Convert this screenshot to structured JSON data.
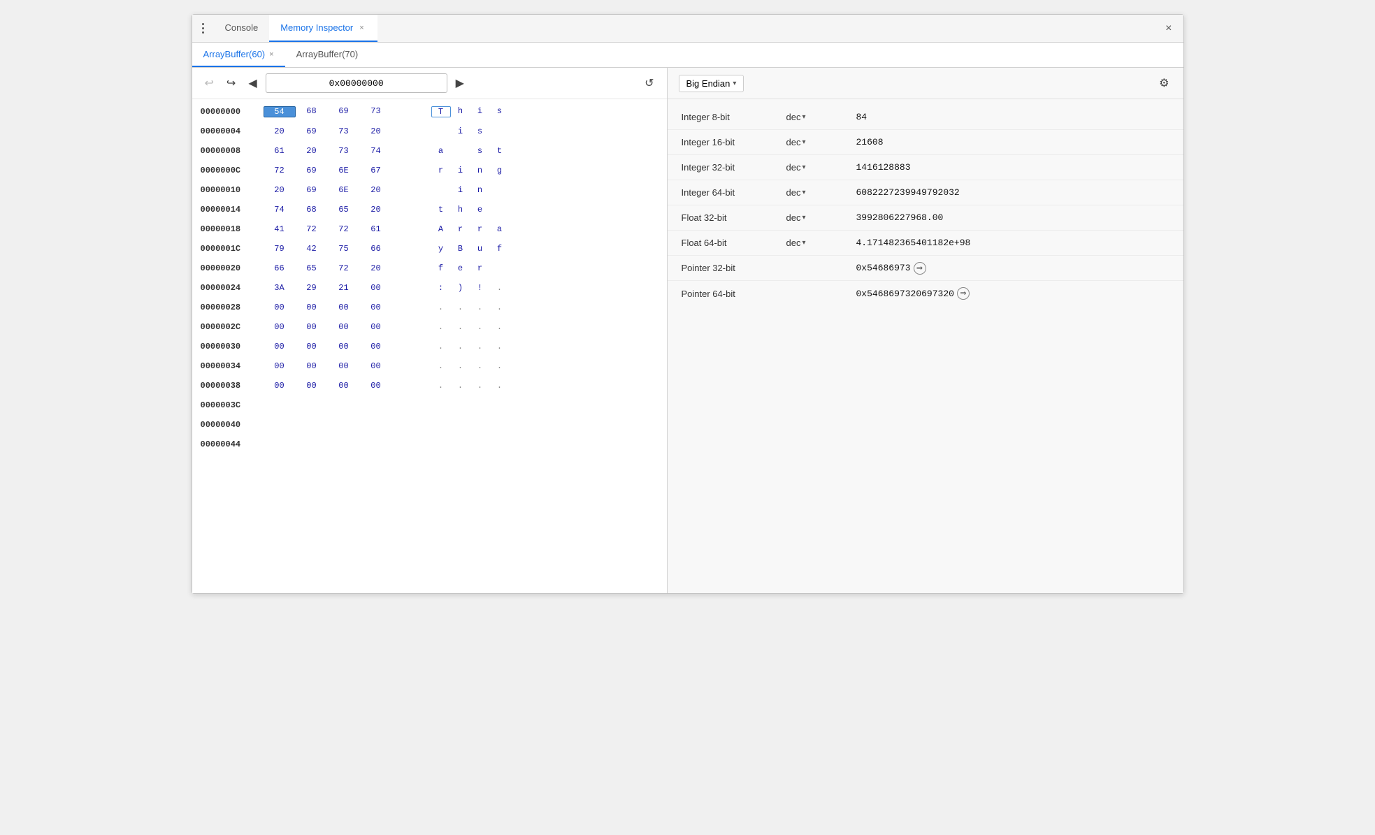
{
  "window": {
    "title": "Memory Inspector",
    "close_label": "×"
  },
  "top_tabs": [
    {
      "id": "console",
      "label": "Console",
      "active": false,
      "closable": false
    },
    {
      "id": "memory-inspector",
      "label": "Memory Inspector",
      "active": true,
      "closable": true
    }
  ],
  "secondary_tabs": [
    {
      "id": "arraybuffer-60",
      "label": "ArrayBuffer(60)",
      "active": true,
      "closable": true
    },
    {
      "id": "arraybuffer-70",
      "label": "ArrayBuffer(70)",
      "active": false,
      "closable": false
    }
  ],
  "nav": {
    "back_disabled": true,
    "forward_disabled": false,
    "address": "0x00000000",
    "prev_icon": "◀",
    "next_icon": "▶",
    "back_icon": "↩",
    "forward_icon": "↪",
    "refresh_icon": "↺"
  },
  "memory_rows": [
    {
      "address": "00000000",
      "bytes": [
        "54",
        "68",
        "69",
        "73"
      ],
      "chars": [
        "T",
        "h",
        "i",
        "s"
      ],
      "byte_selected": 0,
      "char_selected": 0
    },
    {
      "address": "00000004",
      "bytes": [
        "20",
        "69",
        "73",
        "20"
      ],
      "chars": [
        " ",
        "i",
        "s",
        " "
      ],
      "byte_selected": -1,
      "char_selected": -1
    },
    {
      "address": "00000008",
      "bytes": [
        "61",
        "20",
        "73",
        "74"
      ],
      "chars": [
        "a",
        " ",
        "s",
        "t"
      ],
      "byte_selected": -1,
      "char_selected": -1
    },
    {
      "address": "0000000C",
      "bytes": [
        "72",
        "69",
        "6E",
        "67"
      ],
      "chars": [
        "r",
        "i",
        "n",
        "g"
      ],
      "byte_selected": -1,
      "char_selected": -1
    },
    {
      "address": "00000010",
      "bytes": [
        "20",
        "69",
        "6E",
        "20"
      ],
      "chars": [
        " ",
        "i",
        "n",
        " "
      ],
      "byte_selected": -1,
      "char_selected": -1
    },
    {
      "address": "00000014",
      "bytes": [
        "74",
        "68",
        "65",
        "20"
      ],
      "chars": [
        "t",
        "h",
        "e",
        " "
      ],
      "byte_selected": -1,
      "char_selected": -1
    },
    {
      "address": "00000018",
      "bytes": [
        "41",
        "72",
        "72",
        "61"
      ],
      "chars": [
        "A",
        "r",
        "r",
        "a"
      ],
      "byte_selected": -1,
      "char_selected": -1
    },
    {
      "address": "0000001C",
      "bytes": [
        "79",
        "42",
        "75",
        "66"
      ],
      "chars": [
        "y",
        "B",
        "u",
        "f"
      ],
      "byte_selected": -1,
      "char_selected": -1
    },
    {
      "address": "00000020",
      "bytes": [
        "66",
        "65",
        "72",
        "20"
      ],
      "chars": [
        "f",
        "e",
        "r",
        " "
      ],
      "byte_selected": -1,
      "char_selected": -1
    },
    {
      "address": "00000024",
      "bytes": [
        "3A",
        "29",
        "21",
        "00"
      ],
      "chars": [
        ":",
        ")",
        "!",
        "."
      ],
      "byte_selected": -1,
      "char_selected": -1
    },
    {
      "address": "00000028",
      "bytes": [
        "00",
        "00",
        "00",
        "00"
      ],
      "chars": [
        ".",
        ".",
        ".",
        "."
      ],
      "byte_selected": -1,
      "char_selected": -1
    },
    {
      "address": "0000002C",
      "bytes": [
        "00",
        "00",
        "00",
        "00"
      ],
      "chars": [
        ".",
        ".",
        ".",
        "."
      ],
      "byte_selected": -1,
      "char_selected": -1
    },
    {
      "address": "00000030",
      "bytes": [
        "00",
        "00",
        "00",
        "00"
      ],
      "chars": [
        ".",
        ".",
        ".",
        "."
      ],
      "byte_selected": -1,
      "char_selected": -1
    },
    {
      "address": "00000034",
      "bytes": [
        "00",
        "00",
        "00",
        "00"
      ],
      "chars": [
        ".",
        ".",
        ".",
        "."
      ],
      "byte_selected": -1,
      "char_selected": -1
    },
    {
      "address": "00000038",
      "bytes": [
        "00",
        "00",
        "00",
        "00"
      ],
      "chars": [
        ".",
        ".",
        ".",
        "."
      ],
      "byte_selected": -1,
      "char_selected": -1
    },
    {
      "address": "0000003C",
      "bytes": [],
      "chars": [],
      "byte_selected": -1,
      "char_selected": -1
    },
    {
      "address": "00000040",
      "bytes": [],
      "chars": [],
      "byte_selected": -1,
      "char_selected": -1
    },
    {
      "address": "00000044",
      "bytes": [],
      "chars": [],
      "byte_selected": -1,
      "char_selected": -1
    }
  ],
  "right_panel": {
    "endian": "Big Endian",
    "endian_caret": "▾",
    "gear_icon": "⚙",
    "values": [
      {
        "id": "int8",
        "label": "Integer 8-bit",
        "format": "dec",
        "has_dropdown": true,
        "value": "84"
      },
      {
        "id": "int16",
        "label": "Integer 16-bit",
        "format": "dec",
        "has_dropdown": true,
        "value": "21608"
      },
      {
        "id": "int32",
        "label": "Integer 32-bit",
        "format": "dec",
        "has_dropdown": true,
        "value": "1416128883"
      },
      {
        "id": "int64",
        "label": "Integer 64-bit",
        "format": "dec",
        "has_dropdown": true,
        "value": "6082227239949792032"
      },
      {
        "id": "float32",
        "label": "Float 32-bit",
        "format": "dec",
        "has_dropdown": true,
        "value": "3992806227968.00"
      },
      {
        "id": "float64",
        "label": "Float 64-bit",
        "format": "dec",
        "has_dropdown": true,
        "value": "4.171482365401182e+98"
      },
      {
        "id": "ptr32",
        "label": "Pointer 32-bit",
        "format": null,
        "has_dropdown": false,
        "value": "0x54686973",
        "is_pointer": true
      },
      {
        "id": "ptr64",
        "label": "Pointer 64-bit",
        "format": null,
        "has_dropdown": false,
        "value": "0x5468697320697320",
        "is_pointer": true
      }
    ]
  }
}
